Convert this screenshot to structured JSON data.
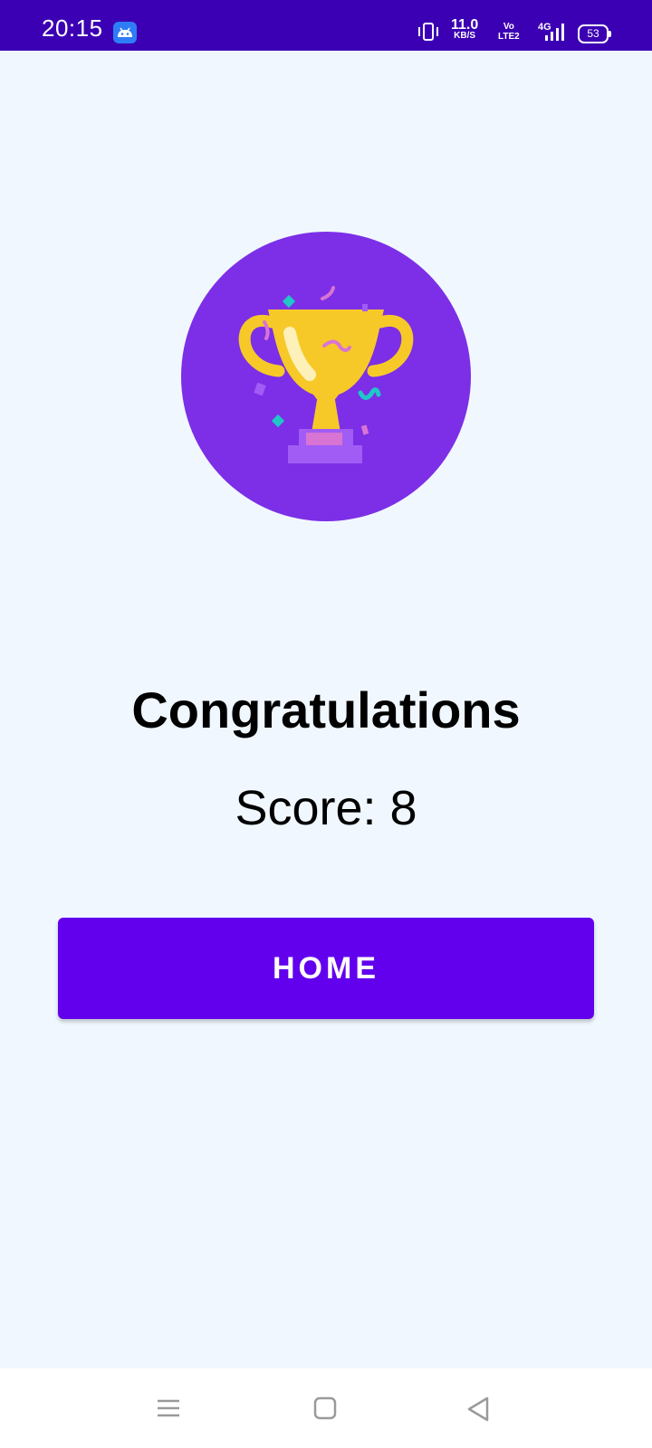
{
  "status_bar": {
    "time": "20:15",
    "net_speed_value": "11.0",
    "net_speed_unit": "KB/S",
    "volte_top": "Vo",
    "volte_bottom": "LTE2",
    "network": "4G",
    "battery": "53",
    "background_color": "#3b00b3",
    "icons": [
      "android-app-icon",
      "vibrate-icon",
      "signal-icon",
      "battery-icon"
    ]
  },
  "result": {
    "title": "Congratulations",
    "score": "Score: 8",
    "trophy_circle_color": "#7c2fe6",
    "icon": "trophy-icon"
  },
  "actions": {
    "home_label": "HOME",
    "home_color": "#6200ee"
  },
  "nav_bar": {
    "icons": [
      "menu-icon",
      "home-square-icon",
      "back-triangle-icon"
    ]
  }
}
